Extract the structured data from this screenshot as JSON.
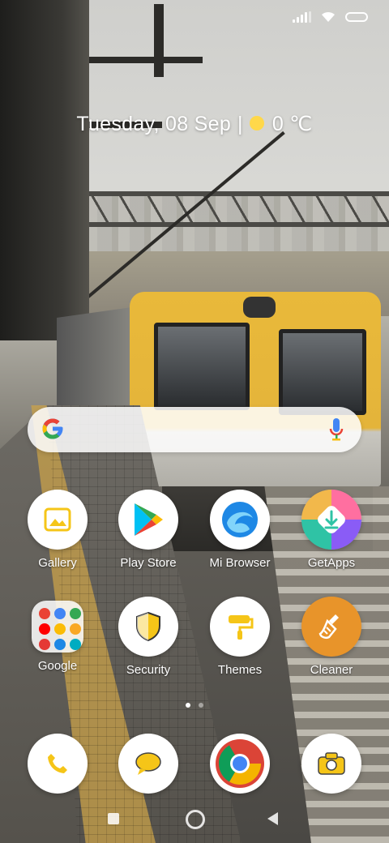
{
  "datetime": {
    "date": "Tuesday, 08 Sep",
    "separator": "|",
    "temperature": "0 ℃",
    "weather_icon": "sun-icon"
  },
  "search": {
    "logo": "google-g-icon",
    "mic": "mic-icon"
  },
  "apps_row1": [
    {
      "label": "Gallery",
      "icon": "gallery-icon"
    },
    {
      "label": "Play Store",
      "icon": "play-store-icon"
    },
    {
      "label": "Mi Browser",
      "icon": "mi-browser-icon"
    },
    {
      "label": "GetApps",
      "icon": "getapps-icon"
    }
  ],
  "apps_row2": [
    {
      "label": "Google",
      "icon": "google-folder-icon"
    },
    {
      "label": "Security",
      "icon": "security-shield-icon"
    },
    {
      "label": "Themes",
      "icon": "themes-paint-roller-icon"
    },
    {
      "label": "Cleaner",
      "icon": "cleaner-brush-icon"
    }
  ],
  "dock": [
    {
      "name": "phone",
      "icon": "phone-icon"
    },
    {
      "name": "messages",
      "icon": "messages-icon"
    },
    {
      "name": "chrome",
      "icon": "chrome-icon"
    },
    {
      "name": "camera",
      "icon": "camera-icon"
    }
  ],
  "page_indicator": {
    "current": 1,
    "total": 2
  },
  "colors": {
    "accent_yellow": "#F5C518",
    "cleaner_orange": "#E8942A"
  }
}
